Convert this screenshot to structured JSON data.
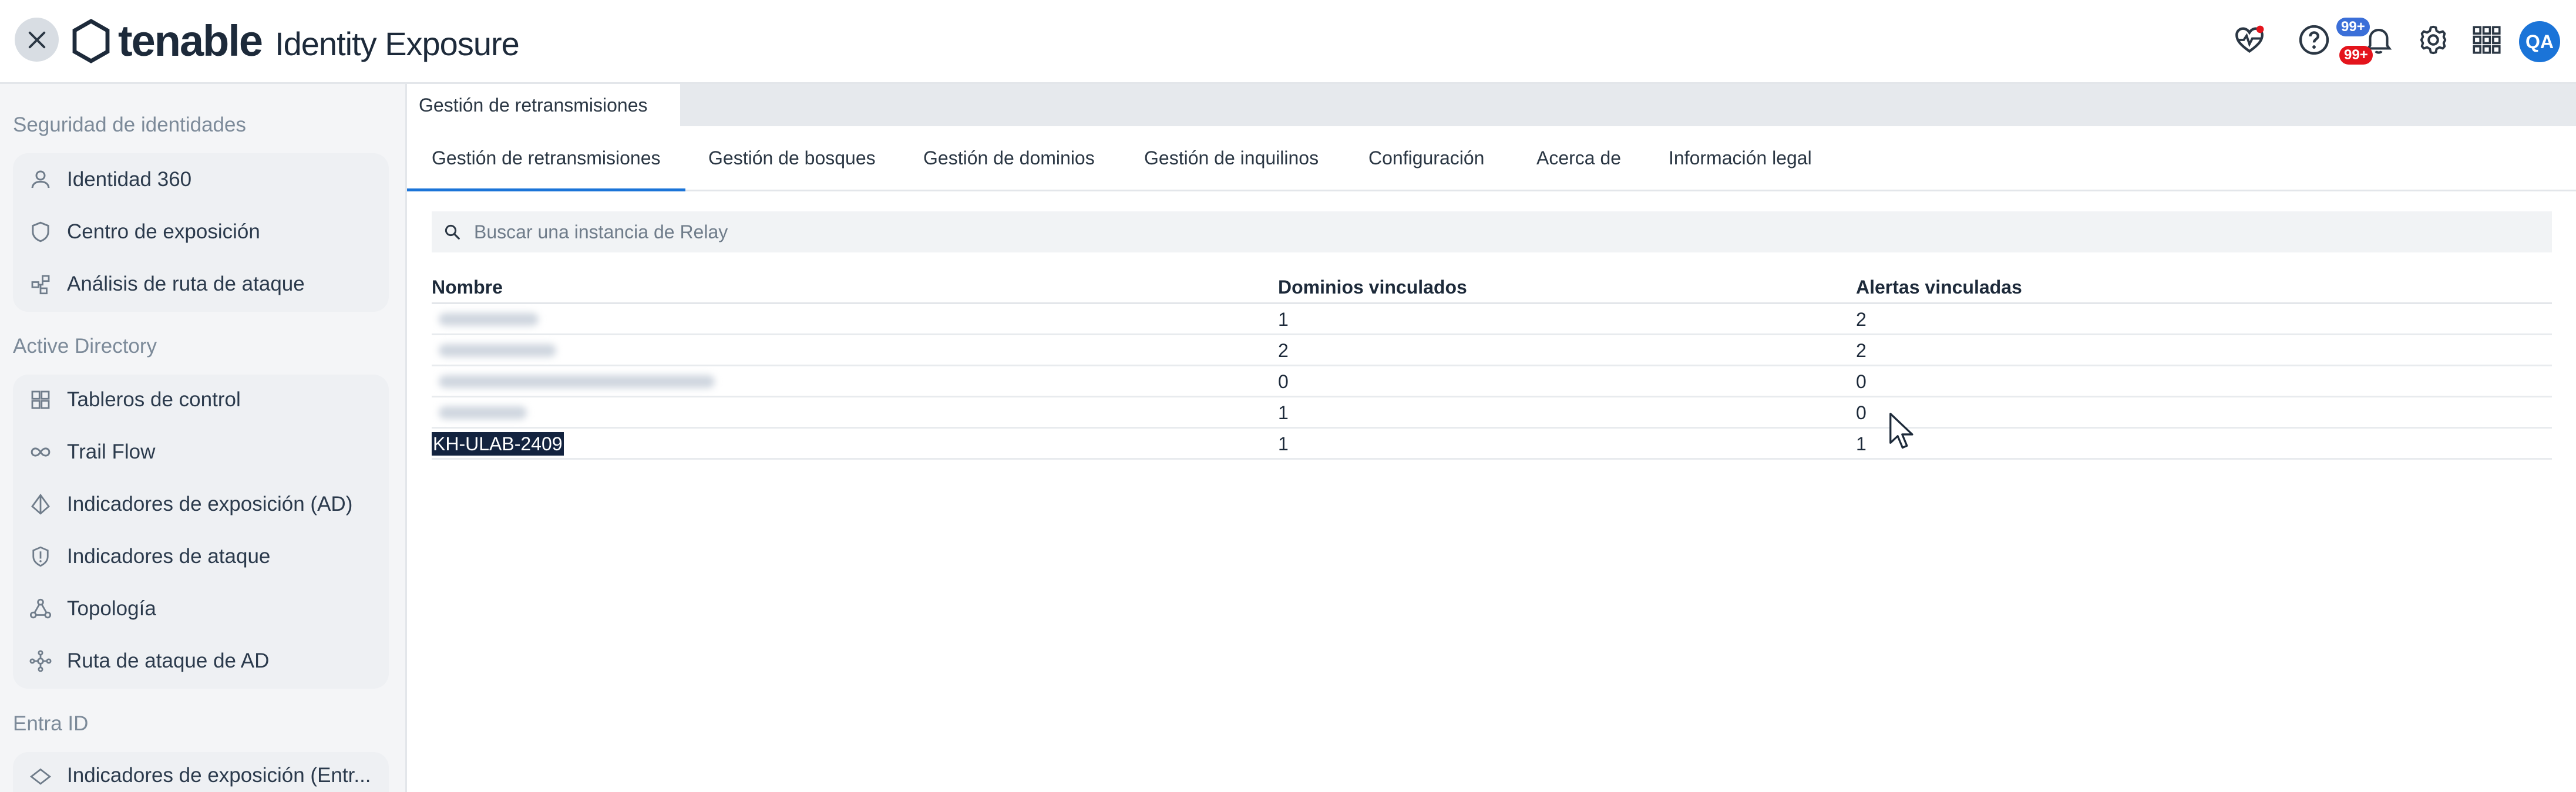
{
  "header": {
    "brand": "tenable",
    "product": "Identity Exposure",
    "notifications_badge_top": "99+",
    "notifications_badge_bottom": "99+",
    "user_initials": "QA",
    "icons": [
      "close-icon",
      "health-icon",
      "help-icon",
      "bell-icon",
      "gear-icon",
      "apps-grid-icon"
    ]
  },
  "sidebar": {
    "sections": [
      {
        "title": "Seguridad de identidades",
        "items": [
          {
            "label": "Identidad 360",
            "icon": "person-icon"
          },
          {
            "label": "Centro de exposición",
            "icon": "shield-icon"
          },
          {
            "label": "Análisis de ruta de ataque",
            "icon": "attack-path-icon"
          }
        ]
      },
      {
        "title": "Active Directory",
        "items": [
          {
            "label": "Tableros de control",
            "icon": "dashboard-icon"
          },
          {
            "label": "Trail Flow",
            "icon": "infinity-icon"
          },
          {
            "label": "Indicadores de exposición (AD)",
            "icon": "exposure-icon"
          },
          {
            "label": "Indicadores de ataque",
            "icon": "attack-shield-icon"
          },
          {
            "label": "Topología",
            "icon": "topology-icon"
          },
          {
            "label": "Ruta de ataque de AD",
            "icon": "path-icon"
          }
        ]
      },
      {
        "title": "Entra ID",
        "items": [
          {
            "label": "Indicadores de exposición (Entr...",
            "icon": "exposure-icon"
          }
        ]
      }
    ]
  },
  "page_tab": "Gestión de retransmisiones",
  "tabs": [
    {
      "label": "Gestión de retransmisiones",
      "active": true
    },
    {
      "label": "Gestión de bosques",
      "active": false
    },
    {
      "label": "Gestión de dominios",
      "active": false
    },
    {
      "label": "Gestión de inquilinos",
      "active": false
    },
    {
      "label": "Configuración",
      "active": false
    },
    {
      "label": "Acerca de",
      "active": false
    },
    {
      "label": "Información legal",
      "active": false
    }
  ],
  "search": {
    "placeholder": "Buscar una instancia de Relay",
    "value": ""
  },
  "table": {
    "columns": [
      "Nombre",
      "Dominios vinculados",
      "Alertas vinculadas"
    ],
    "rows": [
      {
        "name": "",
        "name_obscured": true,
        "domains": "1",
        "alerts": "2"
      },
      {
        "name": "",
        "name_obscured": true,
        "domains": "2",
        "alerts": "2"
      },
      {
        "name": "",
        "name_obscured": true,
        "domains": "0",
        "alerts": "0"
      },
      {
        "name": "",
        "name_obscured": true,
        "domains": "1",
        "alerts": "0"
      },
      {
        "name": "KH-ULAB-2409",
        "name_obscured": false,
        "selected": true,
        "domains": "1",
        "alerts": "1"
      }
    ]
  },
  "colors": {
    "accent": "#1b74d8",
    "badge_blue": "#3b6fd8",
    "badge_red": "#e4141c",
    "sidebar_bg": "#f4f5f7",
    "selection_bg": "#13233f"
  }
}
